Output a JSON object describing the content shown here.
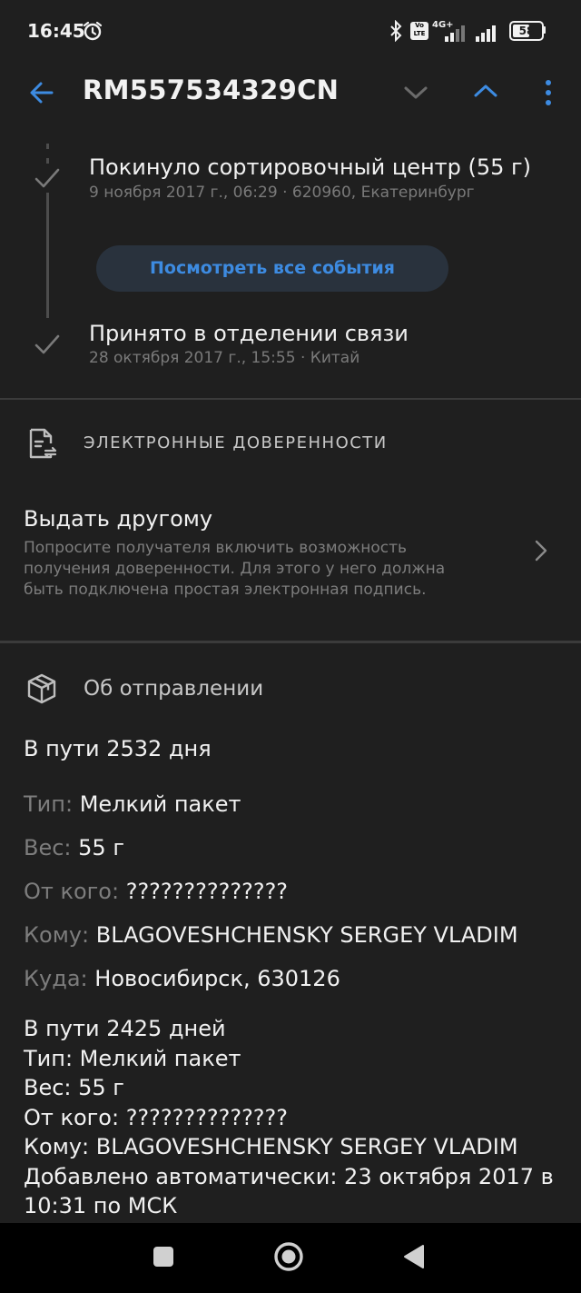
{
  "status_bar": {
    "time": "16:45",
    "network": "4G+",
    "battery": "58"
  },
  "app_bar": {
    "title": "RM557534329CN"
  },
  "events": [
    {
      "title": "Покинуло сортировочный центр (55 г)",
      "subtitle": "9 ноября 2017 г., 06:29 · 620960, Екатеринбург"
    },
    {
      "title": "Принято в отделении связи",
      "subtitle": "28 октября 2017 г., 15:55 · Китай"
    }
  ],
  "all_events_button": "Посмотреть все события",
  "e_proxy": {
    "heading": "ЭЛЕКТРОННЫЕ ДОВЕРЕННОСТИ",
    "item_title": "Выдать другому",
    "item_desc_lines": [
      "Попросите получателя включить возможность",
      "получения доверенности. Для этого у него должна",
      "быть подключена простая электронная подпись."
    ]
  },
  "shipment": {
    "heading": "Об отправлении",
    "in_transit": "В пути 2532 дня",
    "fields": [
      {
        "key": "Тип:",
        "value": "Мелкий пакет"
      },
      {
        "key": "Вес:",
        "value": "55 г"
      },
      {
        "key": "От кого:",
        "value": "??????????????"
      },
      {
        "key": "Кому:",
        "value": "BLAGOVESHCHENSKY SERGEY VLADIM"
      },
      {
        "key": "Куда:",
        "value": "Новосибирск, 630126"
      }
    ],
    "note_lines": [
      "В пути 2425 дней",
      "Тип: Мелкий пакет",
      "Вес: 55 г",
      "От кого: ??????????????",
      "Кому: BLAGOVESHCHENSKY SERGEY VLADIM",
      "Добавлено автоматически: 23 октября 2017 в",
      "10:31 по МСК"
    ]
  }
}
